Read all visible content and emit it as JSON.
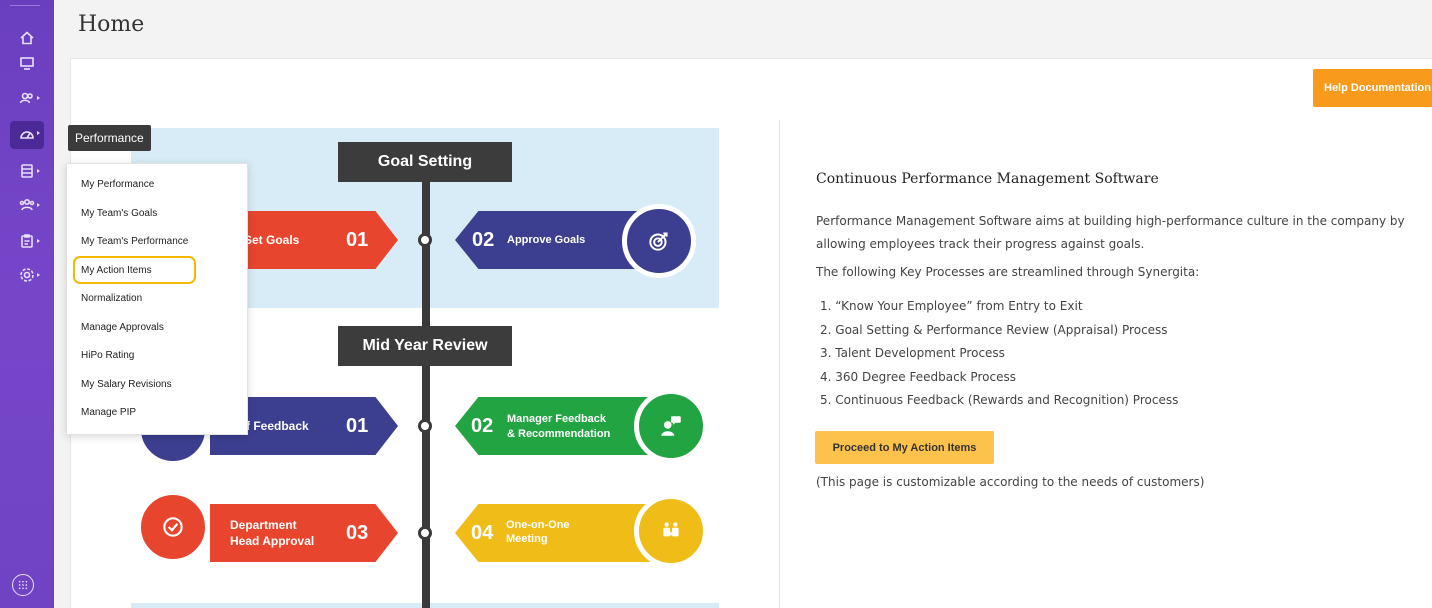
{
  "page": {
    "title": "Home"
  },
  "header": {
    "help_label": "Help Documentation"
  },
  "tooltip": {
    "label": "Performance"
  },
  "menu": {
    "items": [
      "My Performance",
      "My Team's Goals",
      "My Team's Performance",
      "My Action Items",
      "Normalization",
      "Manage Approvals",
      "HiPo Rating",
      "My Salary Revisions",
      "Manage PIP"
    ],
    "highlighted": "My Action Items"
  },
  "sidebar": {
    "icons": [
      "home-icon",
      "monitor-icon",
      "users-icon",
      "gauge-icon",
      "database-icon",
      "team-icon",
      "clipboard-icon",
      "settings-icon"
    ],
    "bottom_icon": "apps-icon"
  },
  "infographic": {
    "section1": "Goal Setting",
    "section2": "Mid Year Review",
    "items": {
      "set_goals": {
        "text": "Set Goals",
        "num": "01"
      },
      "approve_goals": {
        "num": "02",
        "text": "Approve Goals"
      },
      "self_feedback": {
        "text": "f Feedback",
        "num": "01"
      },
      "manager_feedback": {
        "num": "02",
        "text1": "Manager Feedback",
        "text2": "& Recommendation"
      },
      "dept_approval": {
        "text1": "Department",
        "text2": "Head Approval",
        "num": "03"
      },
      "one_on_one": {
        "num": "04",
        "text1": "One-on-One",
        "text2": "Meeting"
      }
    }
  },
  "content": {
    "title": "Continuous Performance Management Software",
    "paragraph": "Performance Management Software aims at building high-performance culture in the company by allowing employees track their progress against goals.",
    "subtitle": "The following Key Processes are streamlined through Synergita:",
    "list": [
      "1. “Know Your Employee” from Entry to Exit",
      "2. Goal Setting & Performance Review (Appraisal) Process",
      "3. Talent Development Process",
      "4. 360 Degree Feedback Process",
      "5. Continuous Feedback (Rewards and Recognition) Process"
    ],
    "button": "Proceed to My Action Items",
    "note": "(This page is customizable according to the needs of customers)"
  },
  "colors": {
    "sidebar": "#6f43c4",
    "help_button": "#f89a1c",
    "proceed_button": "#fdc24b",
    "red": "#e8452f",
    "navy": "#3c3f8f",
    "green": "#23a443",
    "yellow": "#f0bd18",
    "highlight": "#f5b800"
  }
}
